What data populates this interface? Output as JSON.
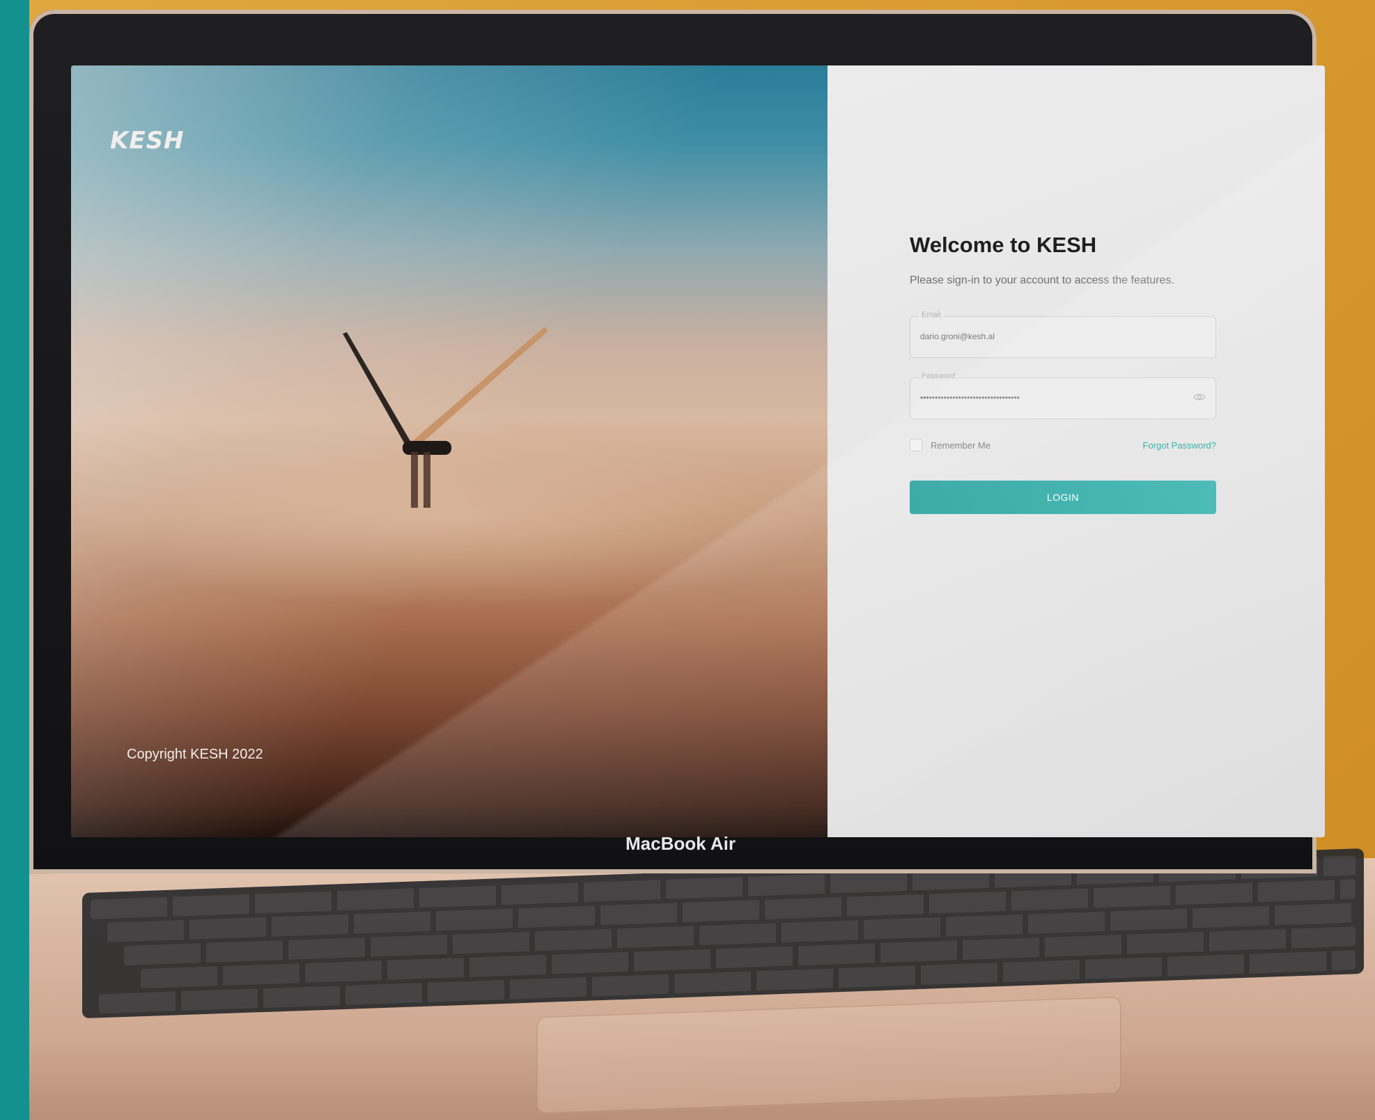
{
  "device": {
    "model_label": "MacBook Air"
  },
  "brand": {
    "logo_text": "KESH"
  },
  "photo_panel": {
    "copyright": "Copyright KESH 2022"
  },
  "login": {
    "title": "Welcome to KESH",
    "subtitle": "Please sign-in to your account to access the features.",
    "email": {
      "label": "Email",
      "value": "dario.groni@kesh.al"
    },
    "password": {
      "label": "Password",
      "value": "••••••••••••••••••••••••••••••••••"
    },
    "remember_label": "Remember Me",
    "remember_checked": false,
    "forgot_label": "Forgot Password?",
    "login_label": "LOGIN"
  },
  "icons": {
    "password_toggle": "eye-icon"
  },
  "colors": {
    "accent": "#2aa9a6",
    "background": "#d99a2e",
    "edge_strip": "#12918f"
  }
}
